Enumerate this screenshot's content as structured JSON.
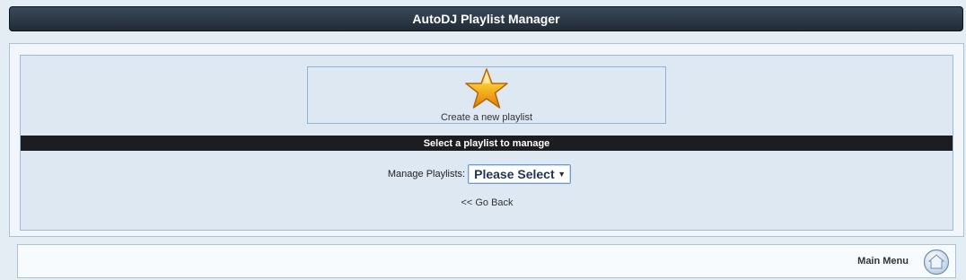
{
  "header": {
    "title": "AutoDJ Playlist Manager"
  },
  "create": {
    "label": "Create a new playlist",
    "icon": "star-icon"
  },
  "section": {
    "title": "Select a playlist to manage"
  },
  "manage": {
    "label": "Manage Playlists:",
    "selected": "Please Select"
  },
  "go_back": {
    "label": "<< Go Back"
  },
  "footer": {
    "main_menu_label": "Main Menu",
    "icon": "home-icon"
  }
}
